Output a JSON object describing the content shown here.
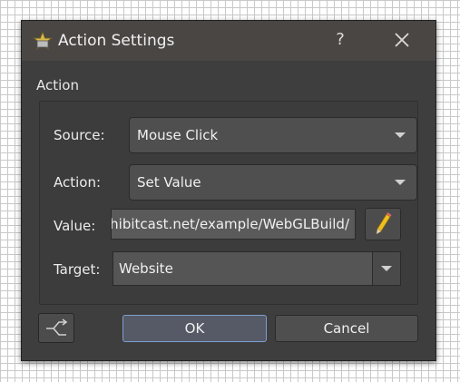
{
  "dialog": {
    "title": "Action Settings",
    "help_label": "?",
    "group_title": "Action"
  },
  "fields": {
    "source": {
      "label": "Source:",
      "value": "Mouse Click"
    },
    "action": {
      "label": "Action:",
      "value": "Set Value"
    },
    "value": {
      "label": "Value:",
      "value": "exhibitcast.net/example/WebGLBuild/"
    },
    "target": {
      "label": "Target:",
      "value": "Website"
    }
  },
  "buttons": {
    "ok": "OK",
    "cancel": "Cancel"
  },
  "icons": {
    "app": "star-icon",
    "close": "close-icon",
    "edit": "pencil-icon",
    "side": "branch-icon"
  },
  "colors": {
    "dialog_bg": "#3e3e3e",
    "titlebar_bg": "#4a4644",
    "accent_border": "#7f9ed0",
    "pencil": "#f0c020"
  }
}
